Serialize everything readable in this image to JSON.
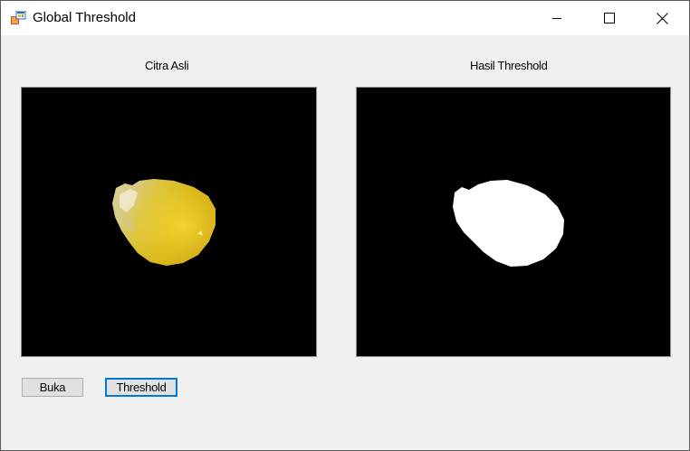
{
  "window": {
    "title": "Global Threshold",
    "app_icon": "winforms-app-icon",
    "controls": {
      "minimize_icon": "minimize-icon",
      "maximize_icon": "maximize-icon",
      "close_icon": "close-icon"
    }
  },
  "panels": {
    "original": {
      "label": "Citra Asli",
      "image": "corn-kernel-color-image"
    },
    "result": {
      "label": "Hasil Threshold",
      "image": "corn-kernel-binary-mask"
    }
  },
  "buttons": {
    "open_label": "Buka",
    "threshold_label": "Threshold"
  },
  "colors": {
    "focus_border": "#0078d7",
    "kernel_yellow": "#e8c81a",
    "mask_white": "#ffffff"
  }
}
